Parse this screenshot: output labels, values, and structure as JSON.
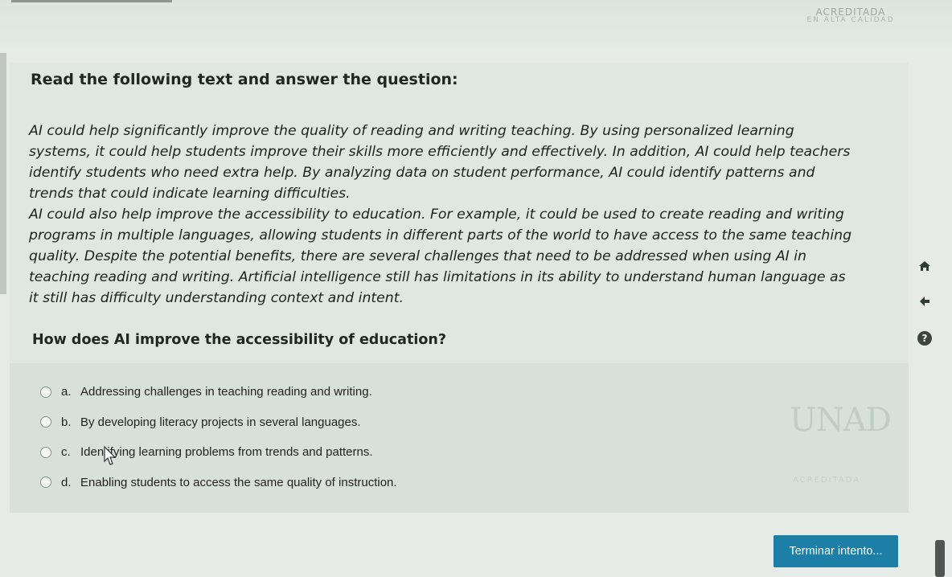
{
  "watermark": {
    "top": "ACREDITADA",
    "top_sub": "EN ALTA CALIDAD"
  },
  "header": {
    "title": "Read the following text and answer the question:"
  },
  "passage": {
    "lines": [
      "AI could help significantly improve the quality of reading and writing teaching. By using personalized learning",
      "systems, it could help students improve their skills more efficiently and effectively. In addition, AI could help teachers",
      "identify students who need extra help. By analyzing data on student performance, AI could identify patterns and",
      "trends that could indicate learning difficulties.",
      "AI could also help improve the accessibility to education. For example, it could be used to create reading and writing",
      "programs in multiple languages, allowing students in different parts of the world to have access to the same teaching",
      "quality. Despite the potential benefits, there are several challenges that need to be addressed when using AI in",
      "teaching reading and writing. Artificial intelligence still has limitations in its ability to understand human language as",
      "it still has difficulty understanding context and intent."
    ]
  },
  "question": {
    "text": "How does AI improve the accessibility of education?"
  },
  "options": [
    {
      "letter": "a.",
      "text": "Addressing challenges in teaching reading and writing."
    },
    {
      "letter": "b.",
      "text": "By developing literacy projects in several languages."
    },
    {
      "letter": "c.",
      "text": "Identifying learning problems from trends and patterns."
    },
    {
      "letter": "d.",
      "text": "Enabling students to access the same quality of instruction."
    }
  ],
  "logo": {
    "text": "UNAD",
    "accreditation": "ACREDITADA"
  },
  "side_icons": [
    "home-icon",
    "back-arrow-icon",
    "help-icon"
  ],
  "help_glyph": "?",
  "finish_button": {
    "label": "Terminar intento..."
  },
  "colors": {
    "accent": "#1d7fa6",
    "panel": "#dfe7e2"
  }
}
